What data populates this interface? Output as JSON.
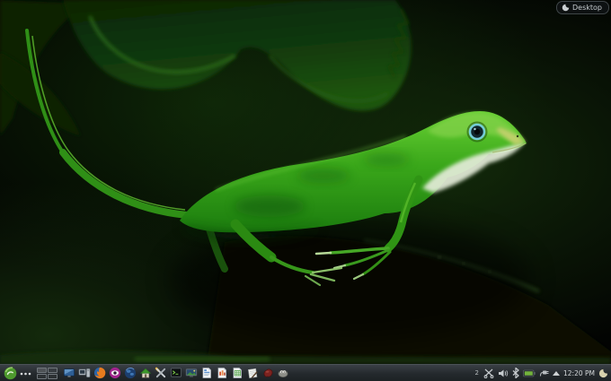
{
  "desktop": {
    "toolbox": {
      "label": "Desktop",
      "icon": "plasma-cashew-icon"
    },
    "wallpaper": {
      "subject": "Green anole lizard climbing on a dark green leaf against a black background",
      "colors": {
        "lizard_green": "#3aa71a",
        "throat_white": "#e4ecd9",
        "eye_ring_blue": "#74ccd6",
        "leaf_green": "#123b0a",
        "background": "#020302"
      }
    }
  },
  "panel": {
    "launcher": {
      "icon": "kickoff-launcher-icon",
      "color": "#55a332"
    },
    "menu_dots_icon": "overflow-dots-icon",
    "pager": {
      "desktops": 4,
      "rows": 2,
      "columns": 2
    },
    "quick_launch_icons": [
      "display-monitor-icon",
      "computer-icon",
      "firefox-icon",
      "eye-viewer-icon",
      "globe-browser-icon",
      "home-folder-icon",
      "utilities-tools-icon",
      "terminal-icon",
      "screen-photo-icon",
      "writer-document-icon",
      "impress-document-icon",
      "calc-document-icon",
      "letter-pen-icon",
      "wax-seal-icon",
      "gimp-mascot-icon"
    ],
    "tray": {
      "badge": "2",
      "icons": [
        "clipboard-scissors-icon",
        "volume-icon",
        "bluetooth-icon",
        "battery-icon",
        "power-plug-icon"
      ],
      "battery_color": "#72b23c",
      "expand_arrow": "up"
    },
    "clock": {
      "time": "12:20 PM"
    },
    "cashew_icon": "panel-cashew-icon"
  }
}
